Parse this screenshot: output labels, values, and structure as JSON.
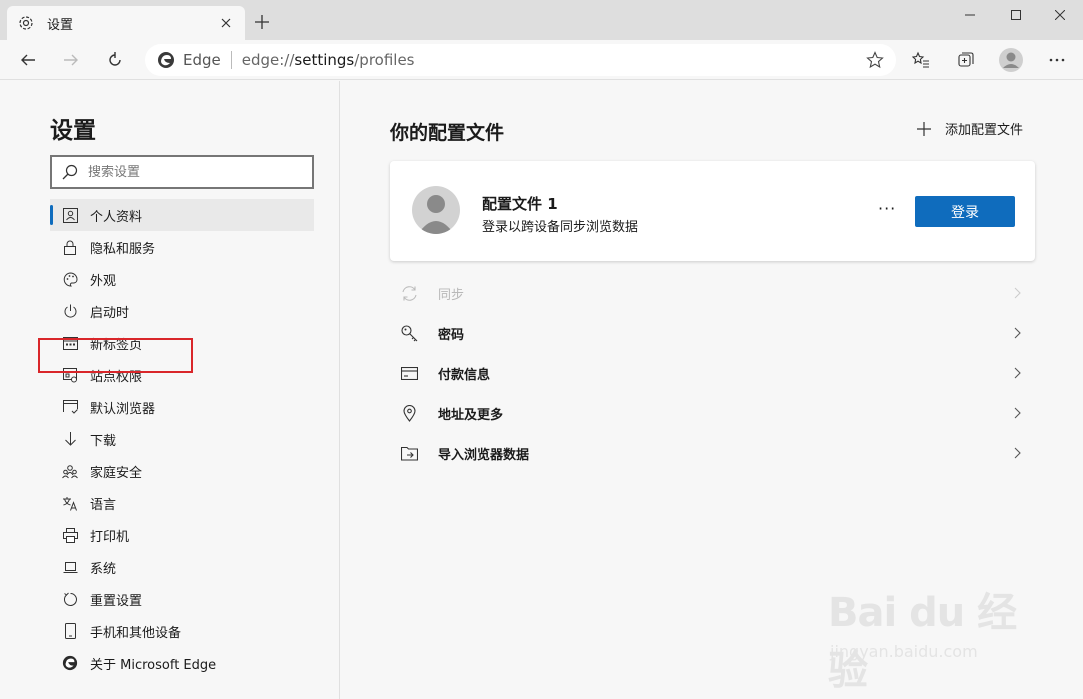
{
  "window": {
    "tab_title": "设置",
    "controls": [
      "minimize",
      "maximize",
      "close"
    ]
  },
  "address_bar": {
    "brand": "Edge",
    "url_prefix": "edge://",
    "url_host": "settings",
    "url_path": "/profiles"
  },
  "sidebar": {
    "title": "设置",
    "search_placeholder": "搜索设置",
    "items": [
      {
        "label": "个人资料",
        "icon": "profile-card-icon",
        "active": true
      },
      {
        "label": "隐私和服务",
        "icon": "lock-icon"
      },
      {
        "label": "外观",
        "icon": "palette-icon"
      },
      {
        "label": "启动时",
        "icon": "power-icon"
      },
      {
        "label": "新标签页",
        "icon": "new-tab-page-icon"
      },
      {
        "label": "站点权限",
        "icon": "site-permissions-icon"
      },
      {
        "label": "默认浏览器",
        "icon": "default-browser-icon"
      },
      {
        "label": "下载",
        "icon": "download-icon",
        "highlighted": true
      },
      {
        "label": "家庭安全",
        "icon": "family-icon"
      },
      {
        "label": "语言",
        "icon": "language-icon"
      },
      {
        "label": "打印机",
        "icon": "printer-icon"
      },
      {
        "label": "系统",
        "icon": "laptop-icon"
      },
      {
        "label": "重置设置",
        "icon": "reset-icon"
      },
      {
        "label": "手机和其他设备",
        "icon": "phone-icon"
      },
      {
        "label": "关于 Microsoft Edge",
        "icon": "edge-logo-icon"
      }
    ]
  },
  "main": {
    "title": "你的配置文件",
    "add_profile": "添加配置文件",
    "profile": {
      "name": "配置文件 1",
      "subtitle": "登录以跨设备同步浏览数据",
      "more": "···",
      "signin_label": "登录"
    },
    "rows": [
      {
        "label": "同步",
        "icon": "sync-icon",
        "disabled": true
      },
      {
        "label": "密码",
        "icon": "key-icon"
      },
      {
        "label": "付款信息",
        "icon": "credit-card-icon"
      },
      {
        "label": "地址及更多",
        "icon": "location-pin-icon"
      },
      {
        "label": "导入浏览器数据",
        "icon": "import-icon"
      }
    ]
  },
  "watermark": {
    "logo_text": "Bai du 经验",
    "site": "jingyan.baidu.com"
  },
  "colors": {
    "accent": "#0f6cbd",
    "highlight_box": "#d9262a",
    "tabstrip": "#dedede",
    "background": "#f7f7f7"
  }
}
